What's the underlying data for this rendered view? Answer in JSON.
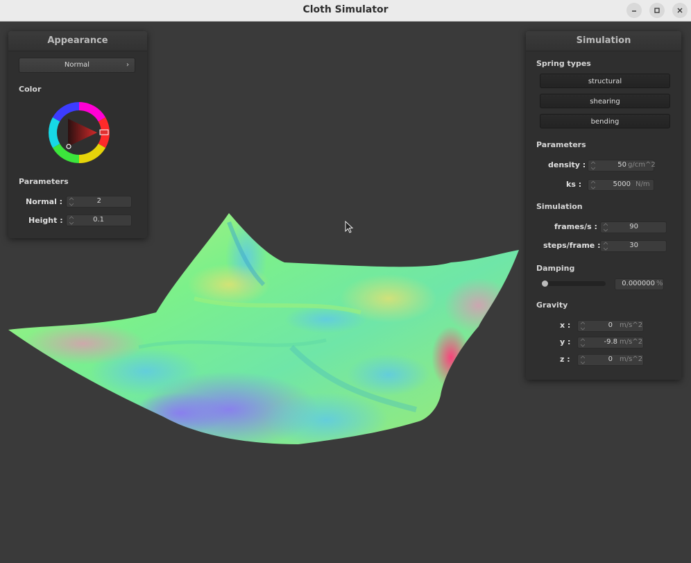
{
  "window": {
    "title": "Cloth Simulator"
  },
  "appearance": {
    "title": "Appearance",
    "shader": "Normal",
    "color_label": "Color",
    "params_label": "Parameters",
    "normal_label": "Normal :",
    "normal_value": "2",
    "height_label": "Height :",
    "height_value": "0.1"
  },
  "simulation": {
    "title": "Simulation",
    "spring_types_label": "Spring types",
    "spring_buttons": [
      "structural",
      "shearing",
      "bending"
    ],
    "parameters_label": "Parameters",
    "density_label": "density :",
    "density_value": "50",
    "density_unit": "g/cm^2",
    "ks_label": "ks :",
    "ks_value": "5000",
    "ks_unit": "N/m",
    "sim_label": "Simulation",
    "fps_label": "frames/s :",
    "fps_value": "90",
    "steps_label": "steps/frame :",
    "steps_value": "30",
    "damping_label": "Damping",
    "damping_value": "0.000000",
    "damping_unit": "%",
    "damping_level": 0,
    "gravity_label": "Gravity",
    "gx_label": "x :",
    "gx_value": "0",
    "gy_label": "y :",
    "gy_value": "-9.8",
    "gz_label": "z :",
    "gz_value": "0",
    "gravity_unit": "m/s^2"
  },
  "colors": {
    "background": "#3a3a3a",
    "panel": "#2f2f2f",
    "accent_red": "#d42a2a"
  }
}
